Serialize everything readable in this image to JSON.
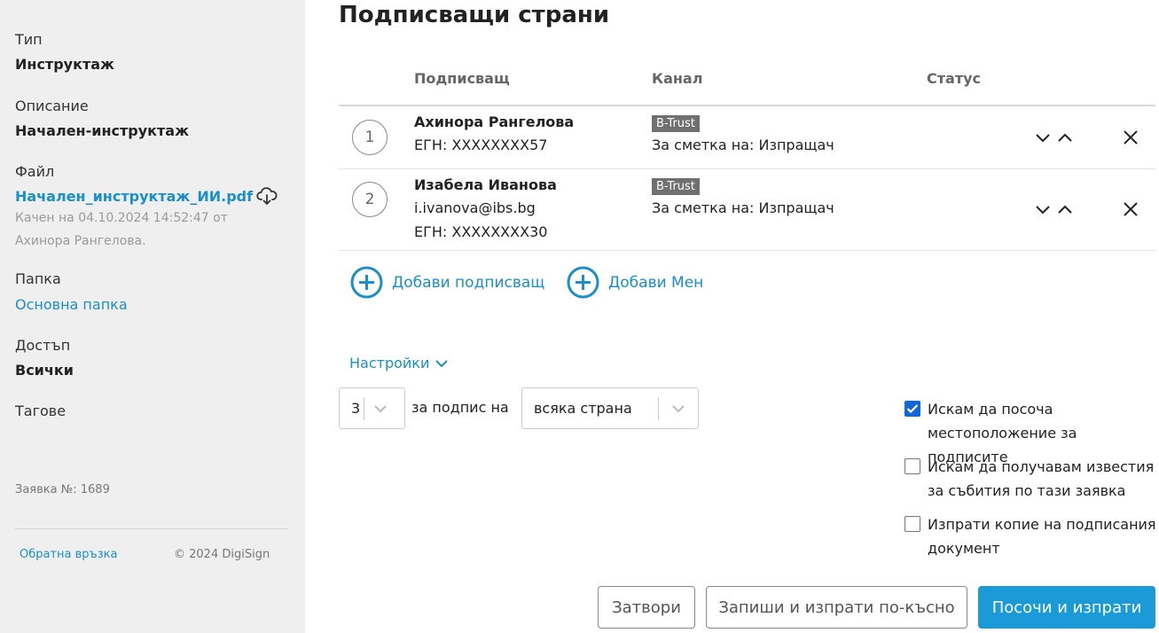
{
  "sidebar": {
    "type_label": "Тип",
    "type_value": "Инструктаж",
    "description_label": "Описание",
    "description_value": "Начален-инструктаж",
    "file_label": "Файл",
    "file_name": "Начален_инструктаж_ИИ.pdf",
    "file_uploaded": "Качен на 04.10.2024 14:52:47 от",
    "file_uploader": "Ахинора Рангелова.",
    "folder_label": "Папка",
    "folder_value": "Основна папка",
    "access_label": "Достъп",
    "access_value": "Всички",
    "tags_label": "Тагове",
    "request_no": "Заявка №: 1689",
    "feedback_link": "Обратна връзка",
    "copyright": "© 2024 DigiSign"
  },
  "main": {
    "title": "Подписващи страни",
    "columns": {
      "signer": "Подписващ",
      "channel": "Канал",
      "status": "Статус"
    },
    "signers": [
      {
        "index": "1",
        "name": "Ахинора Рангелова",
        "lines": [
          "ЕГН: XXXXXXXX57"
        ],
        "channel_badge": "B-Trust",
        "channel_account": "За сметка на: Изпращач"
      },
      {
        "index": "2",
        "name": "Изабела Иванова",
        "lines": [
          "i.ivanova@ibs.bg",
          "ЕГН: XXXXXXXX30"
        ],
        "channel_badge": "B-Trust",
        "channel_account": "За сметка на: Изпращач"
      }
    ],
    "add_signer": "Добави подписващ",
    "add_me": "Добави Мен",
    "settings_label": "Настройки",
    "signature_count": "3",
    "sign_for_label": "за подпис на",
    "party_select": "всяка страна",
    "options": [
      {
        "label": "Искам да посоча местоположение за подписите",
        "checked": true
      },
      {
        "label": "Искам да получавам известия за събития по тази заявка",
        "checked": false
      },
      {
        "label": "Изпрати копие на подписания документ",
        "checked": false
      }
    ],
    "buttons": {
      "close": "Затвори",
      "save_later": "Запиши и изпрати по-късно",
      "submit": "Посочи и изпрати"
    }
  },
  "colors": {
    "accent": "#1a8fc9",
    "primary_button": "#1a9bd7",
    "checkbox": "#1467d4",
    "sidebar_bg": "#efefef",
    "badge": "#707070"
  },
  "icons": [
    "download-cloud-icon",
    "chevron-down-icon",
    "chevron-up-icon",
    "close-icon",
    "plus-circle-icon",
    "checkmark-icon"
  ]
}
